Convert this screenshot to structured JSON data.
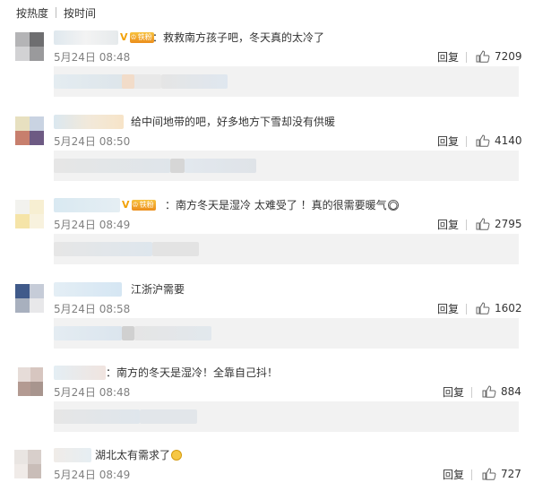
{
  "sort": {
    "hot": "按热度",
    "time": "按时间"
  },
  "reply_label": "回复",
  "comments": [
    {
      "text": "：救救南方孩子吧，冬天真的太冷了",
      "badges": [
        "vip",
        "fan"
      ],
      "time": "5月24日 08:48",
      "likes": "7209",
      "emoji": null
    },
    {
      "text": "给中间地带的吧，好多地方下雪却没有供暖",
      "badges": [],
      "time": "5月24日 08:50",
      "likes": "4140",
      "emoji": null
    },
    {
      "text": "：南方冬天是湿冷 太难受了 ！真的很需要暖气",
      "badges": [
        "vip",
        "fan"
      ],
      "time": "5月24日 08:49",
      "likes": "2795",
      "emoji": "crying-face"
    },
    {
      "text": "江浙沪需要",
      "badges": [],
      "time": "5月24日 08:58",
      "likes": "1602",
      "emoji": null
    },
    {
      "text": "：南方的冬天是湿冷！全靠自己抖！",
      "badges": [],
      "time": "5月24日 08:48",
      "likes": "884",
      "emoji": null
    },
    {
      "text": "湖北太有需求了",
      "badges": [],
      "time": "5月24日 08:49",
      "likes": "727",
      "emoji": "thinking-face"
    }
  ],
  "badge_labels": {
    "vip": "V",
    "fan": "铁粉"
  },
  "colors": {
    "text": "#333333",
    "time": "#808080",
    "sub_bg": "#f2f2f2",
    "badge": "#f2a20a"
  }
}
